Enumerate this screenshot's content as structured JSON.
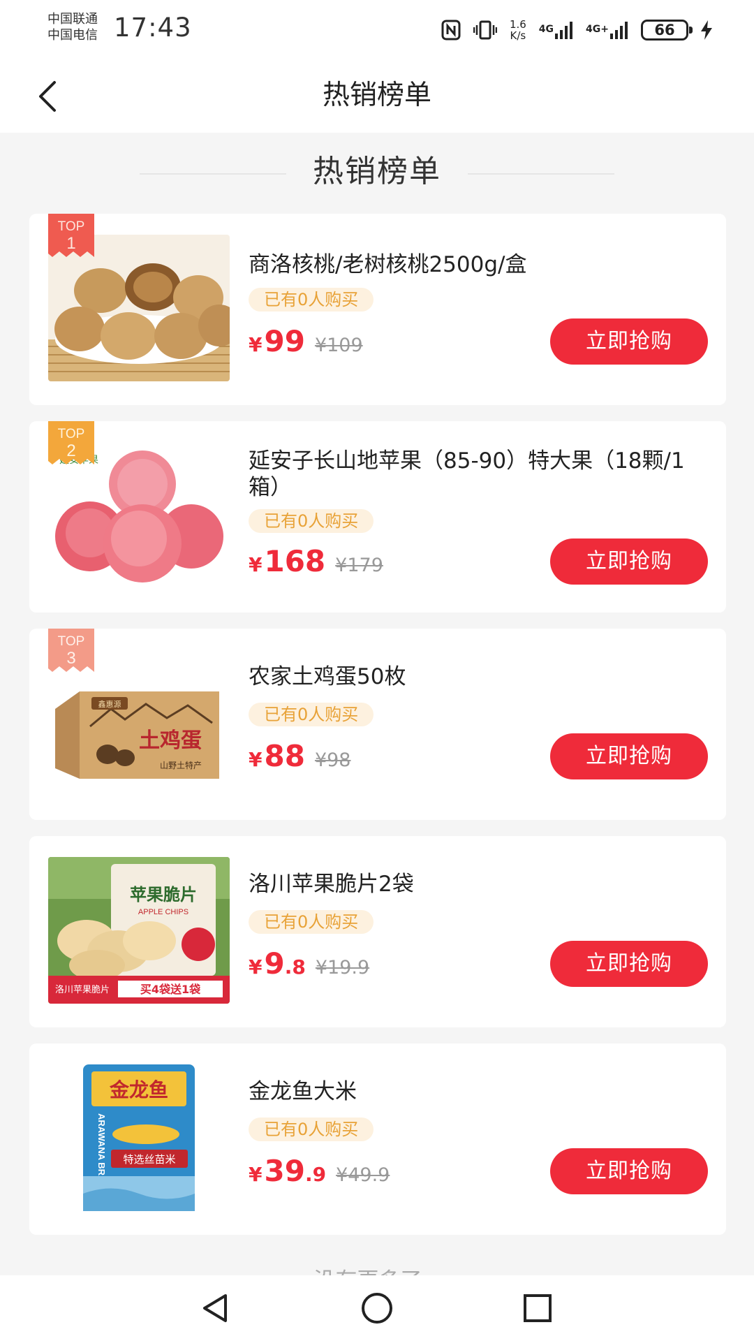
{
  "status_bar": {
    "carrier_1": "中国联通",
    "carrier_2": "中国电信",
    "time": "17:43",
    "speed_value": "1.6",
    "speed_unit": "K/s",
    "network_1": "4G",
    "network_2": "4G+",
    "battery": "66"
  },
  "nav": {
    "title": "热销榜单"
  },
  "section": {
    "title": "热销榜单"
  },
  "badge_text": "TOP",
  "buy_label": "立即抢购",
  "products": [
    {
      "rank": "1",
      "title": "商洛核桃/老树核桃2500g/盒",
      "buyers": "已有0人购买",
      "price_int": "99",
      "price_dec": "",
      "original": "¥109"
    },
    {
      "rank": "2",
      "title": "延安子长山地苹果（85-90）特大果（18颗/1箱）",
      "buyers": "已有0人购买",
      "price_int": "168",
      "price_dec": "",
      "original": "¥179"
    },
    {
      "rank": "3",
      "title": "农家土鸡蛋50枚",
      "buyers": "已有0人购买",
      "price_int": "88",
      "price_dec": "",
      "original": "¥98"
    },
    {
      "rank": "",
      "title": "洛川苹果脆片2袋",
      "buyers": "已有0人购买",
      "price_int": "9",
      "price_dec": ".8",
      "original": "¥19.9"
    },
    {
      "rank": "",
      "title": "金龙鱼大米",
      "buyers": "已有0人购买",
      "price_int": "39",
      "price_dec": ".9",
      "original": "¥49.9"
    }
  ],
  "currency": "¥",
  "image_text": {
    "apple_brand": "延安苹果",
    "egg_box_brand": "鑫惠源",
    "egg_box_title": "土鸡蛋",
    "egg_box_sub": "山野土特产",
    "chips_brand": "苹果脆片",
    "chips_en": "APPLE CHIPS",
    "chips_banner": "洛川苹果脆片",
    "chips_promo": "买4袋送1袋",
    "rice_brand": "金龙鱼",
    "rice_en": "ARAWANA BRAND",
    "rice_type": "特选丝苗米"
  },
  "footer": "没有更多了~",
  "icons": {
    "back": "chevron-left-icon",
    "nfc": "nfc-icon",
    "vibrate": "vibrate-icon",
    "signal": "signal-icon",
    "charging": "lightning-icon"
  }
}
